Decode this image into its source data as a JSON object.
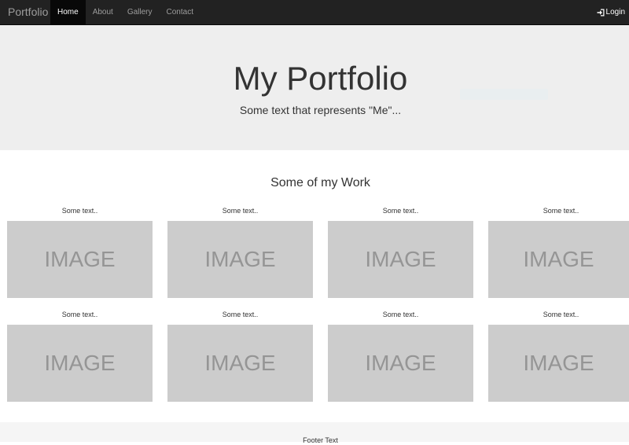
{
  "navbar": {
    "brand": "Portfolio",
    "items": [
      {
        "label": "Home"
      },
      {
        "label": "About"
      },
      {
        "label": "Gallery"
      },
      {
        "label": "Contact"
      }
    ],
    "login_label": "Login",
    "login_icon": "log-in-icon"
  },
  "jumbotron": {
    "title": "My Portfolio",
    "subtitle": "Some text that represents \"Me\"..."
  },
  "work": {
    "title": "Some of my Work",
    "items": [
      {
        "caption": "Some text..",
        "image_text": "IMAGE"
      },
      {
        "caption": "Some text..",
        "image_text": "IMAGE"
      },
      {
        "caption": "Some text..",
        "image_text": "IMAGE"
      },
      {
        "caption": "Some text..",
        "image_text": "IMAGE"
      },
      {
        "caption": "Some text..",
        "image_text": "IMAGE"
      },
      {
        "caption": "Some text..",
        "image_text": "IMAGE"
      },
      {
        "caption": "Some text..",
        "image_text": "IMAGE"
      },
      {
        "caption": "Some text..",
        "image_text": "IMAGE"
      }
    ]
  },
  "footer": {
    "text": "Footer Text"
  },
  "colors": {
    "navbar_bg": "#222222",
    "active_bg": "#080808",
    "jumbotron_bg": "#eeeeee",
    "image_bg": "#cccccc",
    "footer_bg": "#f5f5f5"
  }
}
